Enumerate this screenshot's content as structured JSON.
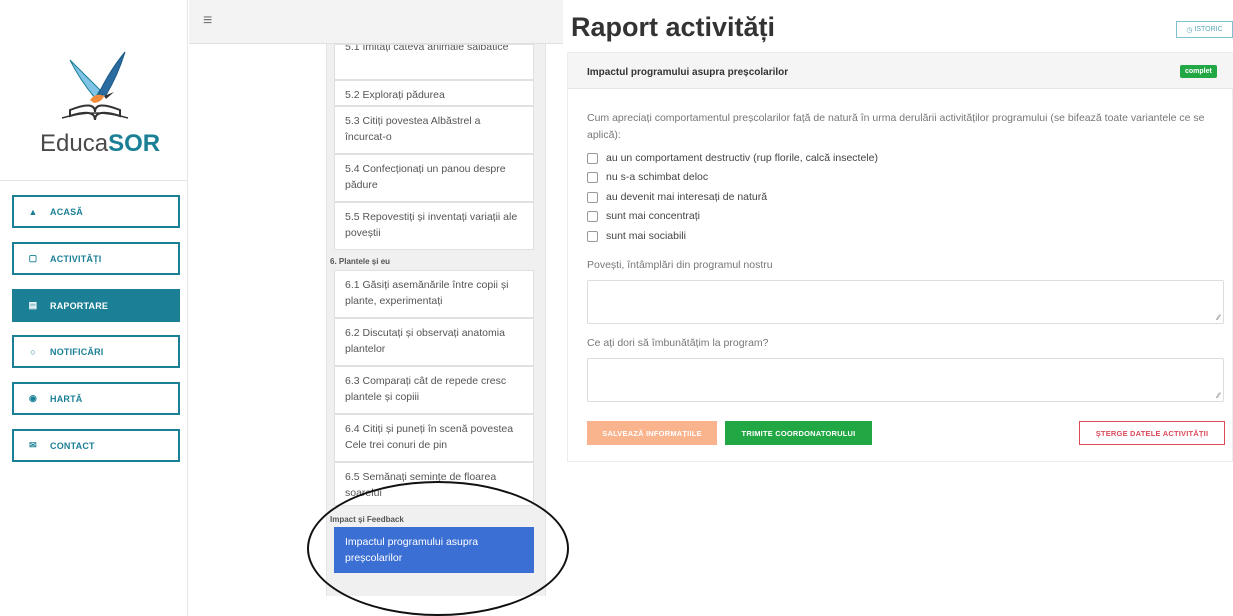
{
  "app": {
    "logo_text_a": "Educa",
    "logo_text_b": "SOR"
  },
  "sidebar": {
    "items": [
      {
        "label": "ACASĂ",
        "icon": "home-icon"
      },
      {
        "label": "ACTIVITĂȚI",
        "icon": "calendar-icon"
      },
      {
        "label": "RAPORTARE",
        "icon": "report-icon"
      },
      {
        "label": "NOTIFICĂRI",
        "icon": "bell-icon"
      },
      {
        "label": "HARTĂ",
        "icon": "map-pin-icon"
      },
      {
        "label": "CONTACT",
        "icon": "envelope-icon"
      }
    ]
  },
  "topbar": {
    "menu_glyph": "≡"
  },
  "activities": {
    "items": [
      {
        "label": "5.1 Imitați câteva animale sălbatice"
      },
      {
        "label": "5.2 Explorați pădurea"
      },
      {
        "label": "5.3 Citiți povestea Albăstrel a încurcat-o"
      },
      {
        "label": "5.4 Confecționați un panou despre pădure"
      },
      {
        "label": "5.5 Repovestiți și inventați variații ale poveștii"
      }
    ],
    "group_6_label": "6. Plantele și eu",
    "group_6_items": [
      {
        "label": "6.1 Găsiți asemănările între copii și plante, experimentați"
      },
      {
        "label": "6.2 Discutați și observați anatomia plantelor"
      },
      {
        "label": "6.3 Comparați cât de repede cresc plantele și copiii"
      },
      {
        "label": "6.4 Citiți și puneți în scenă povestea Cele trei conuri de pin"
      },
      {
        "label": "6.5 Semănați semințe de floarea soarelui"
      }
    ],
    "group_impact_label": "Impact și Feedback",
    "selected_label": "Impactul programului asupra preșcolarilor"
  },
  "main": {
    "title": "Raport activități",
    "istoric_label": "ISTORIC",
    "card_title": "Impactul programului asupra preșcolarilor",
    "status_badge": "complet",
    "question": "Cum apreciați comportamentul preșcolarilor față de natură în urma derulării activităților programului (se bifează toate variantele ce se aplică):",
    "options": [
      "au un comportament destructiv (rup florile, calcă insectele)",
      "nu s-a schimbat deloc",
      "au devenit mai interesați de natură",
      "sunt mai concentrați",
      "sunt mai sociabili"
    ],
    "stories_label": "Povești, întâmplări din programul nostru",
    "stories_value": "",
    "improve_label": "Ce ați dori să îmbunătățim la program?",
    "improve_value": "",
    "save_label": "SALVEAZĂ INFORMAȚIILE",
    "send_label": "TRIMITE COORDONATORULUI",
    "delete_label": "ȘTERGE DATELE ACTIVITĂȚII"
  },
  "colors": {
    "accent": "#1b7f95",
    "selected_blue": "#3b6fd4",
    "success": "#22a745",
    "danger": "#dc4a5a",
    "save_orange": "#f9b48e"
  }
}
